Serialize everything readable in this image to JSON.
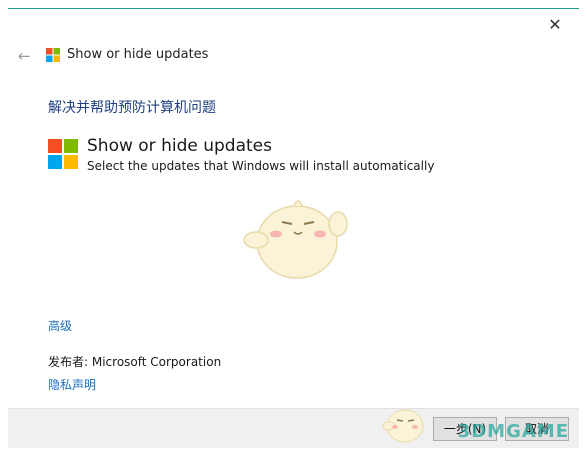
{
  "window": {
    "close_glyph": "✕",
    "back_glyph": "←",
    "title": "Show or hide updates"
  },
  "main": {
    "heading": "解决并帮助预防计算机问题",
    "app_title": "Show or hide updates",
    "app_subtitle": "Select the updates that Windows will install automatically",
    "advanced_link": "高级",
    "publisher": "发布者: Microsoft Corporation",
    "privacy_link": "隐私声明"
  },
  "footer": {
    "next_button": "一步(N)",
    "cancel_button": "取消"
  },
  "watermark": {
    "text": "3DMGAME"
  },
  "colors": {
    "accent_line": "#1c9a8a",
    "link": "#1a6fc0",
    "heading": "#1f3f80",
    "ms_red": "#f25022",
    "ms_green": "#7fba00",
    "ms_blue": "#00a4ef",
    "ms_yellow": "#ffb900"
  }
}
